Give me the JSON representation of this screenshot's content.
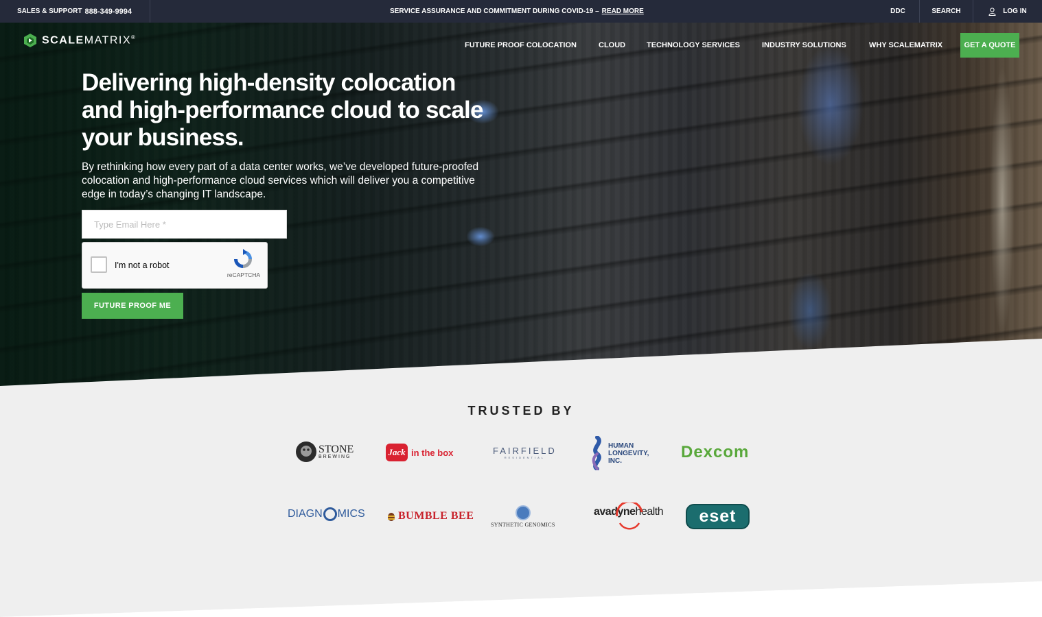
{
  "topbar": {
    "support_label": "SALES & SUPPORT",
    "phone": "888-349-9994",
    "notice": "SERVICE ASSURANCE AND COMMITMENT DURING COVID-19 –",
    "notice_link": "READ MORE",
    "ddc": "DDC",
    "search": "SEARCH",
    "login": "LOG IN"
  },
  "brand": {
    "name_bold": "SCALE",
    "name_light": "MATRIX",
    "mark": "®",
    "accent": "#4caf50",
    "dark": "#252a3a"
  },
  "nav": {
    "items": [
      "FUTURE PROOF COLOCATION",
      "CLOUD",
      "TECHNOLOGY SERVICES",
      "INDUSTRY SOLUTIONS",
      "WHY SCALEMATRIX"
    ],
    "quote": "GET A QUOTE"
  },
  "hero": {
    "title": "Delivering high-density colocation and high-performance cloud to scale your business.",
    "subtitle": "By rethinking how every part of a data center works, we’ve developed future-proofed colocation and high-performance cloud services which will deliver you a competitive edge in today’s changing IT landscape.",
    "email_placeholder": "Type Email Here *",
    "email_value": "",
    "captcha_label": "I'm not a robot",
    "captcha_brand": "reCAPTCHA",
    "cta": "FUTURE PROOF ME"
  },
  "trusted": {
    "title": "TRUSTED BY",
    "logos": {
      "stone_1": "STONE",
      "stone_2": "BREWING",
      "jack_badge": "Jack",
      "jack_text": "in the box",
      "fairfield_1": "FAIRFIELD",
      "fairfield_2": "RESIDENTIAL",
      "hli_1": "HUMAN",
      "hli_2": "LONGEVITY,",
      "hli_3": "INC.",
      "dexcom": "Dexcom",
      "diag_1": "DIAGN",
      "diag_2": "MICS",
      "bumble": "BUMBLE BEE",
      "synth": "SYNTHETIC GENOMICS",
      "avadyne_1": "avadyne",
      "avadyne_2": "health",
      "eset": "eset"
    }
  }
}
